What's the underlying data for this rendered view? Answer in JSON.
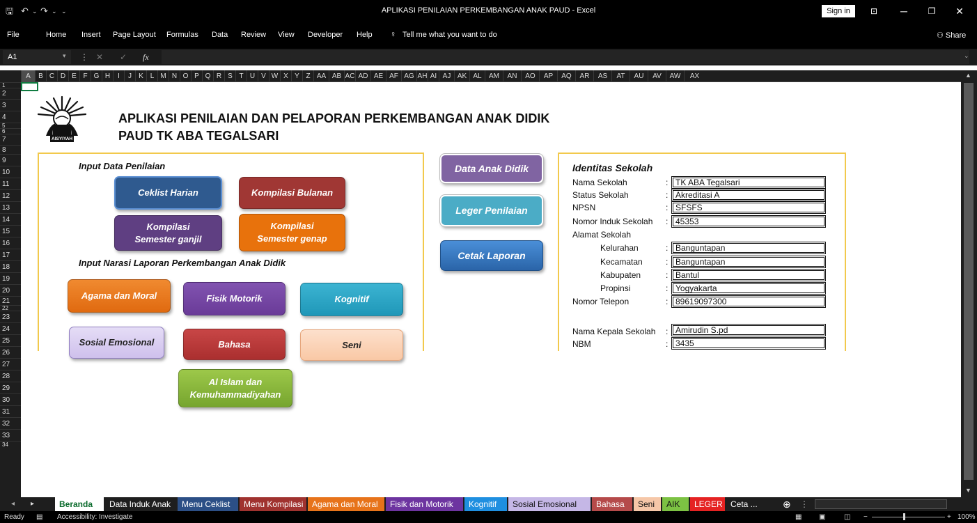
{
  "window": {
    "title": "APLIKASI PENILAIAN PERKEMBANGAN ANAK PAUD  -  Excel",
    "sign_in": "Sign in"
  },
  "ribbon": {
    "tabs": [
      "File",
      "Home",
      "Insert",
      "Page Layout",
      "Formulas",
      "Data",
      "Review",
      "View",
      "Developer",
      "Help"
    ],
    "tell_me": "Tell me what you want to do",
    "share": "Share"
  },
  "formula_bar": {
    "name_box": "A1",
    "fx": "fx",
    "value": ""
  },
  "columns": [
    "A",
    "B",
    "C",
    "D",
    "E",
    "F",
    "G",
    "H",
    "I",
    "J",
    "K",
    "L",
    "M",
    "N",
    "O",
    "P",
    "Q",
    "R",
    "S",
    "T",
    "U",
    "V",
    "W",
    "X",
    "Y",
    "Z",
    "AA",
    "AB",
    "AC",
    "AD",
    "AE",
    "AF",
    "AG",
    "AH",
    "AI",
    "AJ",
    "AK",
    "AL",
    "AM",
    "AN",
    "AO",
    "AP",
    "AQ",
    "AR",
    "AS",
    "AT",
    "AU",
    "AV",
    "AW",
    "AX"
  ],
  "rows": [
    "1",
    "2",
    "3",
    "4",
    "5",
    "6",
    "7",
    "8",
    "9",
    "10",
    "11",
    "12",
    "13",
    "14",
    "15",
    "16",
    "17",
    "18",
    "19",
    "20",
    "21",
    "22",
    "23",
    "24",
    "25",
    "26",
    "27",
    "28",
    "29",
    "30",
    "31",
    "32",
    "33",
    "34"
  ],
  "header": {
    "logo_text": "AISYIYAH",
    "title_line1": "APLIKASI PENILAIAN DAN PELAPORAN PERKEMBANGAN ANAK DIDIK",
    "title_line2": "PAUD TK ABA TEGALSARI"
  },
  "input_section": {
    "label": "Input Data Penilaian",
    "buttons": {
      "ceklist_harian": "Ceklist Harian",
      "kompilasi_bulanan": "Kompilasi Bulanan",
      "kompilasi_ganjil": "Kompilasi Semester ganjil",
      "kompilasi_genap": "Kompilasi Semester genap"
    }
  },
  "narasi_section": {
    "label": "Input Narasi Laporan Perkembangan Anak Didik",
    "buttons": {
      "agama": "Agama dan Moral",
      "fisik": "Fisik Motorik",
      "kognitif": "Kognitif",
      "sosial": "Sosial Emosional",
      "bahasa": "Bahasa",
      "seni": "Seni",
      "aik": "Al Islam dan Kemuhammadiyahan"
    }
  },
  "middle_buttons": {
    "data_anak": "Data Anak Didik",
    "leger": "Leger Penilaian",
    "cetak": "Cetak Laporan"
  },
  "identitas": {
    "title": "Identitas Sekolah",
    "colon": ":",
    "fields": [
      {
        "label": "Nama Sekolah",
        "value": "TK ABA Tegalsari"
      },
      {
        "label": "Status Sekolah",
        "value": "Akreditasi A"
      },
      {
        "label": "NPSN",
        "value": "SFSFS"
      },
      {
        "label": "Nomor Induk Sekolah",
        "value": "45353"
      }
    ],
    "alamat_label": "Alamat Sekolah",
    "alamat": [
      {
        "label": "Kelurahan",
        "value": "Banguntapan"
      },
      {
        "label": "Kecamatan",
        "value": "Banguntapan"
      },
      {
        "label": "Kabupaten",
        "value": "Bantul"
      },
      {
        "label": "Propinsi",
        "value": "Yogyakarta"
      }
    ],
    "telepon": {
      "label": "Nomor Telepon",
      "value": "89619097300"
    },
    "kepala": {
      "label": "Nama Kepala Sekolah",
      "value": "Amirudin S.pd"
    },
    "nbm": {
      "label": "NBM",
      "value": "3435"
    }
  },
  "sheet_tabs": [
    {
      "label": "Beranda",
      "bg": "#ffffff",
      "fg": "#0a6b2c"
    },
    {
      "label": "Data Induk Anak",
      "bg": "#1e1e1e",
      "fg": "#ffffff"
    },
    {
      "label": "Menu Ceklist",
      "bg": "#2c4f86",
      "fg": "#ffffff"
    },
    {
      "label": "Menu Kompilasi",
      "bg": "#a0322f",
      "fg": "#ffffff"
    },
    {
      "label": "Agama dan Moral",
      "bg": "#e7731a",
      "fg": "#ffffff"
    },
    {
      "label": "Fisik dan Motorik",
      "bg": "#6d34a0",
      "fg": "#ffffff"
    },
    {
      "label": "Kognitif",
      "bg": "#1f8fe0",
      "fg": "#ffffff"
    },
    {
      "label": "Sosial Emosional",
      "bg": "#c5b7e6",
      "fg": "#111111"
    },
    {
      "label": "Bahasa",
      "bg": "#b54a4a",
      "fg": "#ffffff"
    },
    {
      "label": "Seni",
      "bg": "#f6c7a8",
      "fg": "#111111"
    },
    {
      "label": "AIK",
      "bg": "#7cc243",
      "fg": "#111111"
    },
    {
      "label": "LEGER",
      "bg": "#e52222",
      "fg": "#ffffff"
    },
    {
      "label": "Ceta ...",
      "bg": "#1e1e1e",
      "fg": "#ffffff"
    }
  ],
  "status_bar": {
    "ready": "Ready",
    "accessibility": "Accessibility: Investigate",
    "zoom": "100%"
  },
  "colors": {
    "panel_border": "#f2c94c",
    "ceklist": "#2f5a8f",
    "bulanan": "#a03734",
    "ganjil": "#5f3f82",
    "genap": "#e8720c",
    "data_anak": "#8064a2",
    "leger": "#4bacc6",
    "cetak": "#2e6bb0"
  }
}
